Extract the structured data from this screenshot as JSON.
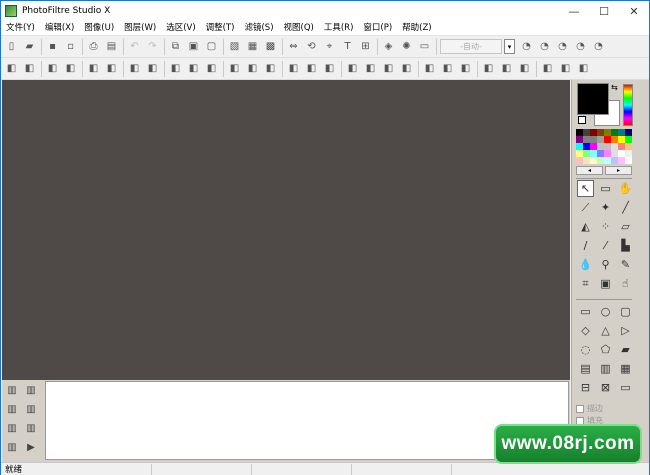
{
  "window": {
    "title": "PhotoFiltre Studio X",
    "controls": [
      "—",
      "☐",
      "✕"
    ]
  },
  "menu": [
    {
      "label": "文件(Y)"
    },
    {
      "label": "编辑(X)"
    },
    {
      "label": "图像(U)"
    },
    {
      "label": "图层(W)"
    },
    {
      "label": "选区(V)"
    },
    {
      "label": "调整(T)"
    },
    {
      "label": "滤镜(S)"
    },
    {
      "label": "视图(Q)"
    },
    {
      "label": "工具(R)"
    },
    {
      "label": "窗口(P)"
    },
    {
      "label": "帮助(Z)"
    }
  ],
  "toolbar": {
    "zoom_combo": "自动",
    "combo_arrow": "▾",
    "row1_icons": [
      "new-file",
      "open-file",
      "sep",
      "save",
      "save-as",
      "sep",
      "print",
      "scan",
      "sep",
      "undo",
      "redo",
      "sep",
      "copy",
      "paste",
      "paste-new",
      "sep",
      "crop",
      "resize",
      "canvas",
      "sep",
      "flip",
      "rotate",
      "transform",
      "text",
      "image-size",
      "sep",
      "plugin",
      "magic",
      "browser",
      "sep"
    ],
    "row2_icons": [
      "select-add",
      "select-sub",
      "sep",
      "pick-1",
      "pick-2",
      "sep",
      "level-1",
      "level-2",
      "sep",
      "star-1",
      "star-2",
      "sep",
      "balance",
      "contrast",
      "gradient",
      "sep",
      "mask",
      "shape",
      "frame",
      "sep",
      "auto-a",
      "auto-b",
      "auto-c",
      "sep",
      "fx-1",
      "fx-2",
      "fx-3",
      "fx-4",
      "sep",
      "fx-5",
      "fx-6",
      "fx-7",
      "sep",
      "layer-1",
      "layer-2",
      "layer-3",
      "sep",
      "win-1",
      "win-2",
      "win-3"
    ]
  },
  "palette_colors": [
    "#000000",
    "#404040",
    "#800000",
    "#804000",
    "#808000",
    "#008000",
    "#008080",
    "#000080",
    "#800080",
    "#808080",
    "#808080",
    "#a0a0a0",
    "#ff0000",
    "#ff8000",
    "#ffff00",
    "#00ff00",
    "#00ffff",
    "#0000ff",
    "#ff00ff",
    "#c0c0c0",
    "#c0c0c0",
    "#e0e0e0",
    "#ff8080",
    "#ffc080",
    "#ffff80",
    "#80ff80",
    "#80ffff",
    "#8080ff",
    "#ff80ff",
    "#e0e0e0",
    "#ffffff",
    "#f0f0f0",
    "#ffc0c0",
    "#ffe0c0",
    "#ffffc0",
    "#c0ffc0",
    "#c0ffff",
    "#c0c0ff",
    "#ffc0ff",
    "#ffffff"
  ],
  "palette_nav": {
    "prev": "◂",
    "next": "▸"
  },
  "tools": [
    {
      "id": "pointer",
      "glyph": "↖",
      "active": true
    },
    {
      "id": "selection",
      "glyph": "▭",
      "active": false
    },
    {
      "id": "hand",
      "glyph": "✋",
      "active": false
    },
    {
      "id": "eyedropper",
      "glyph": "⟋",
      "active": false
    },
    {
      "id": "magic-wand",
      "glyph": "✦",
      "active": false
    },
    {
      "id": "line",
      "glyph": "╱",
      "active": false
    },
    {
      "id": "fill",
      "glyph": "◭",
      "active": false
    },
    {
      "id": "spray",
      "glyph": "⁘",
      "active": false
    },
    {
      "id": "eraser",
      "glyph": "▱",
      "active": false
    },
    {
      "id": "brush",
      "glyph": "∕",
      "active": false
    },
    {
      "id": "advanced-brush",
      "glyph": "⁄",
      "active": false
    },
    {
      "id": "stamp",
      "glyph": "▙",
      "active": false
    },
    {
      "id": "blur",
      "glyph": "💧",
      "active": false
    },
    {
      "id": "smudge",
      "glyph": "⚲",
      "active": false
    },
    {
      "id": "dodge",
      "glyph": "✎",
      "active": false
    },
    {
      "id": "pattern",
      "glyph": "⌗",
      "active": false
    },
    {
      "id": "clone",
      "glyph": "▣",
      "active": false
    },
    {
      "id": "finger",
      "glyph": "☝",
      "active": false
    }
  ],
  "shape_tools": [
    {
      "id": "rectangle",
      "glyph": "▭"
    },
    {
      "id": "ellipse",
      "glyph": "○"
    },
    {
      "id": "rounded-rect",
      "glyph": "▢"
    },
    {
      "id": "diamond",
      "glyph": "◇"
    },
    {
      "id": "triangle",
      "glyph": "△"
    },
    {
      "id": "triangle-right",
      "glyph": "▷"
    },
    {
      "id": "lasso",
      "glyph": "◌"
    },
    {
      "id": "polygon",
      "glyph": "⬠"
    },
    {
      "id": "freeform",
      "glyph": "▰"
    },
    {
      "id": "sel-1",
      "glyph": "▤"
    },
    {
      "id": "sel-2",
      "glyph": "▥"
    },
    {
      "id": "sel-3",
      "glyph": "▦"
    },
    {
      "id": "sel-4",
      "glyph": "⊟"
    },
    {
      "id": "sel-5",
      "glyph": "⊠"
    },
    {
      "id": "sel-6",
      "glyph": "▭"
    }
  ],
  "options": [
    {
      "label": "描边"
    },
    {
      "label": "填充"
    }
  ],
  "bottom_icons": [
    "doc-1",
    "doc-2",
    "doc-3",
    "doc-4",
    "doc-5",
    "doc-6",
    "doc-7",
    "play"
  ],
  "status": {
    "text": "就绪"
  },
  "watermark": {
    "text": "www.08rj.com"
  }
}
